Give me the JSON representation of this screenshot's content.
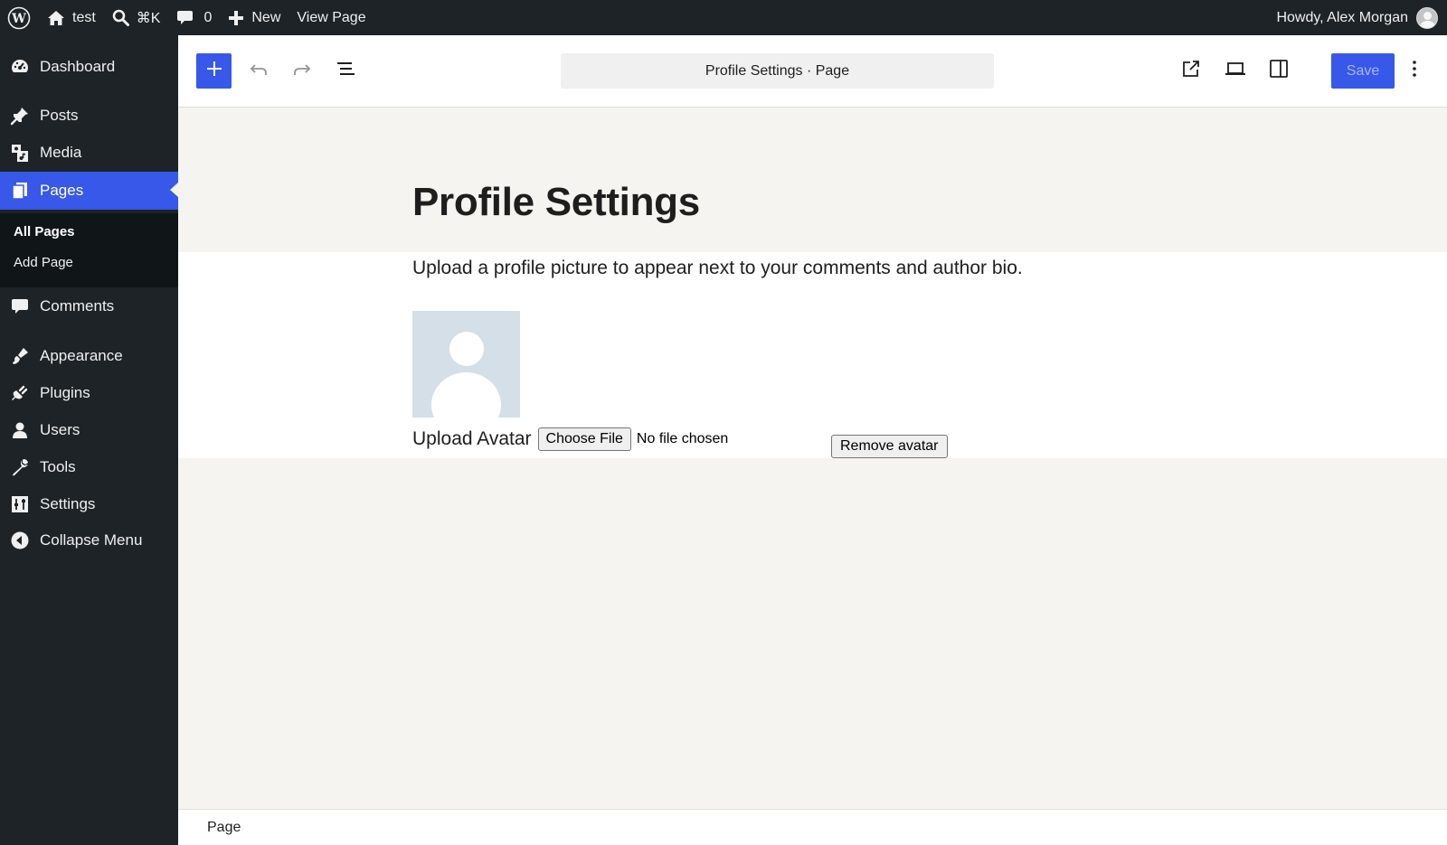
{
  "admin_bar": {
    "site_name": "test",
    "search_shortcut": "⌘K",
    "comments_count": "0",
    "new_label": "New",
    "view_page_label": "View Page",
    "howdy_text": "Howdy, Alex Morgan"
  },
  "sidebar": {
    "items": [
      {
        "label": "Dashboard",
        "icon": "dashboard-icon"
      },
      {
        "label": "Posts",
        "icon": "pin-icon"
      },
      {
        "label": "Media",
        "icon": "media-icon"
      },
      {
        "label": "Pages",
        "icon": "pages-icon",
        "current": true
      },
      {
        "label": "Comments",
        "icon": "comment-icon"
      },
      {
        "label": "Appearance",
        "icon": "brush-icon"
      },
      {
        "label": "Plugins",
        "icon": "plug-icon"
      },
      {
        "label": "Users",
        "icon": "user-icon"
      },
      {
        "label": "Tools",
        "icon": "wrench-icon"
      },
      {
        "label": "Settings",
        "icon": "sliders-icon"
      },
      {
        "label": "Collapse Menu",
        "icon": "collapse-icon"
      }
    ],
    "submenu": {
      "all_pages": "All Pages",
      "add_page": "Add Page"
    }
  },
  "toolbar": {
    "document_title": "Profile Settings · Page",
    "save_label": "Save"
  },
  "content": {
    "heading": "Profile Settings",
    "intro": "Upload a profile picture to appear next to your comments and author bio.",
    "upload_label": "Upload Avatar",
    "choose_file_label": "Choose File",
    "file_status": "No file chosen",
    "remove_label": "Remove avatar"
  },
  "footer": {
    "breadcrumb": "Page"
  },
  "colors": {
    "admin_dark": "#1d2327",
    "accent": "#3858e9",
    "canvas_bg": "#f5f4f1"
  }
}
